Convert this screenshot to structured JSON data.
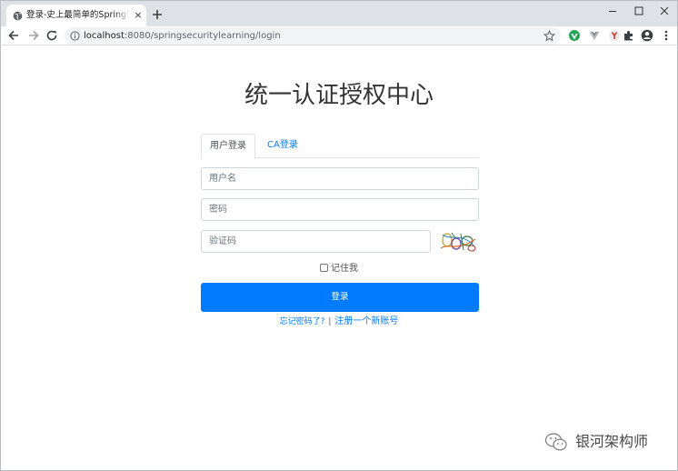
{
  "browser": {
    "tab_title": "登录-史上最简单的SpringSecurity教程",
    "tab_close": "×",
    "url_host": "localhost",
    "url_rest": ":8080/springsecuritylearning/login"
  },
  "page": {
    "title": "统一认证授权中心",
    "tabs": [
      {
        "label": "用户登录",
        "active": true
      },
      {
        "label": "CA登录",
        "active": false
      }
    ],
    "username_placeholder": "用户名",
    "password_placeholder": "密码",
    "captcha_placeholder": "验证码",
    "remember_label": "记住我",
    "login_button": "登录",
    "forgot_password_link": "忘记密码了?",
    "separator": "|",
    "register_link": "注册一个新账号"
  },
  "watermark": {
    "text": "银河架构师"
  },
  "colors": {
    "primary": "#007bff",
    "tabstrip": "#dee1e6",
    "omnibox": "#f1f3f4"
  }
}
